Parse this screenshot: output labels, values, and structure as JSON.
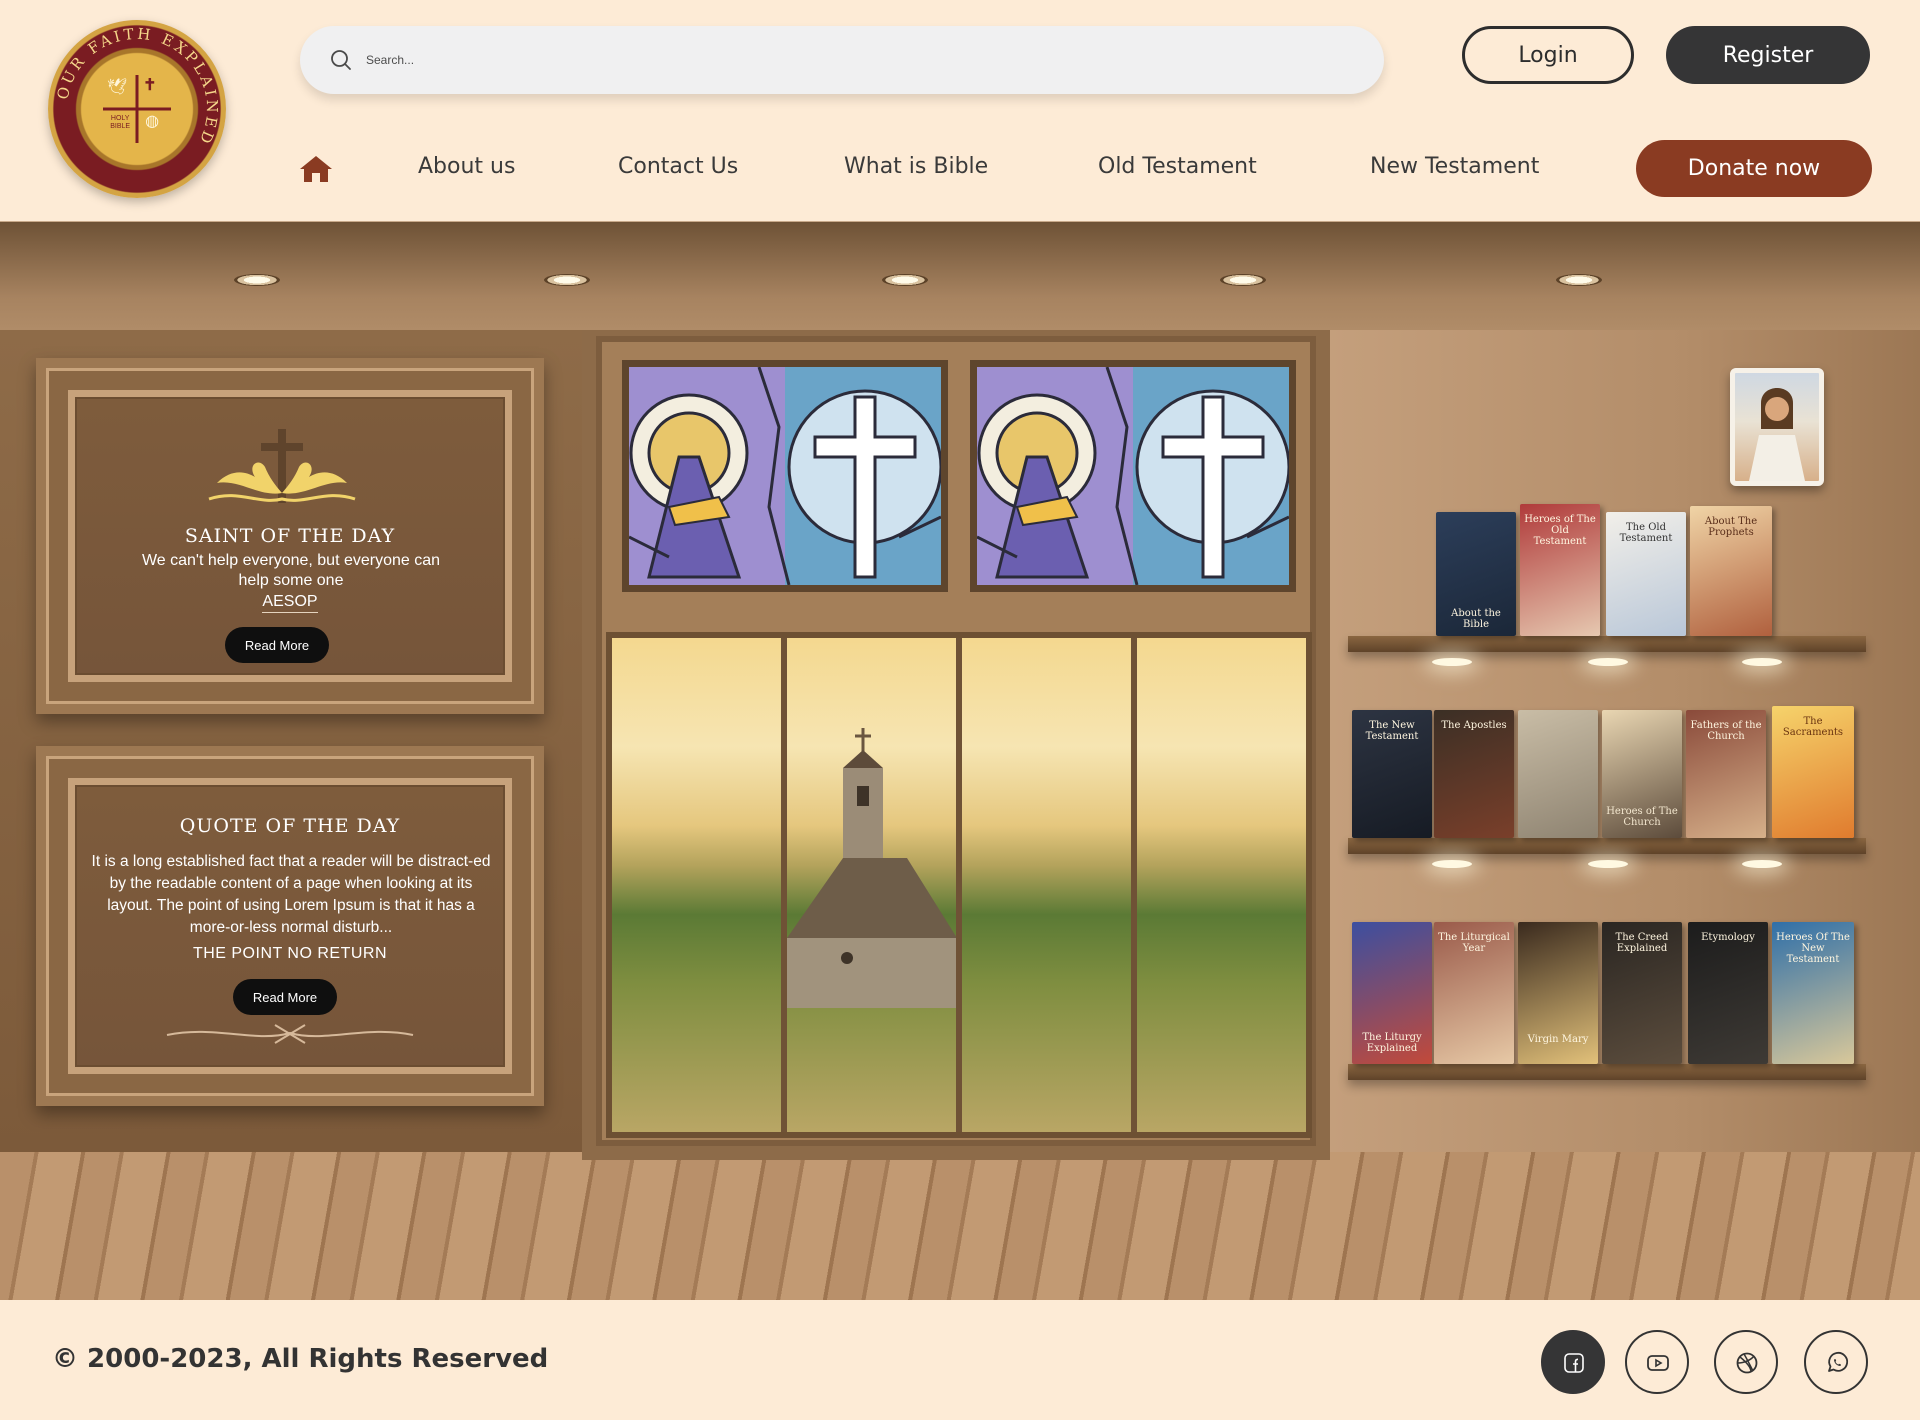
{
  "logo": {
    "ring_text": "OUR FAITH EXPLAINED",
    "book_label": "HOLY BIBLE"
  },
  "search": {
    "placeholder": "Search..."
  },
  "auth": {
    "login_label": "Login",
    "register_label": "Register"
  },
  "nav": {
    "home_icon": "home-icon",
    "items": [
      "About us",
      "Contact Us",
      "What is Bible",
      "Old Testament",
      "New Testament"
    ],
    "donate_label": "Donate now"
  },
  "saint": {
    "title": "SAINT OF THE DAY",
    "text": "We can't help everyone, but everyone can help some one",
    "author": "AESOP",
    "button": "Read More"
  },
  "quote": {
    "title": "QUOTE OF THE DAY",
    "text": "It is a long established fact that a reader will be distract-ed by the readable content of a page when looking at its layout. The point of using Lorem Ipsum is that it has a more-or-less normal disturb...",
    "author": "THE POINT NO RETURN",
    "button": "Read More"
  },
  "books": {
    "shelf1": [
      "About the Bible",
      "Heroes of The Old Testament",
      "The Old Testament",
      "About The Prophets"
    ],
    "shelf2": [
      "The New Testament",
      "The Apostles",
      "",
      "Heroes of The Church",
      "Fathers of the Church",
      "The Sacraments"
    ],
    "shelf3": [
      "The Liturgy Explained",
      "The Liturgical Year",
      "Virgin Mary",
      "The Creed Explained",
      "Etymology",
      "Heroes Of The New Testament"
    ]
  },
  "footer": {
    "copyright": "© 2000-2023, All Rights Reserved",
    "social": [
      "facebook-icon",
      "youtube-icon",
      "dribbble-icon",
      "whatsapp-icon"
    ]
  },
  "colors": {
    "accent": "#8a3b22",
    "dark_button": "#353536",
    "header_bg": "#fdebd6"
  }
}
